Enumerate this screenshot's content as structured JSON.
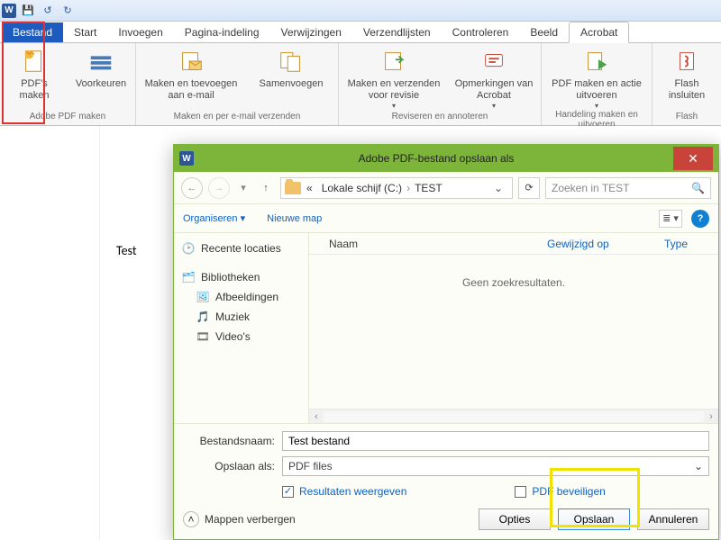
{
  "tabs": {
    "file": "Bestand",
    "home": "Start",
    "insert": "Invoegen",
    "layout": "Pagina-indeling",
    "refs": "Verwijzingen",
    "mail": "Verzendlijsten",
    "review": "Controleren",
    "view": "Beeld",
    "acrobat": "Acrobat"
  },
  "ribbon": {
    "g1": {
      "label": "Adobe PDF maken",
      "btn1": "PDF's maken",
      "btn2": "Voorkeuren"
    },
    "g2": {
      "label": "Maken en per e-mail verzenden",
      "btn1": "Maken en toevoegen aan e-mail",
      "btn2": "Samenvoegen"
    },
    "g3": {
      "label": "Reviseren en annoteren",
      "btn1": "Maken en verzenden voor revisie",
      "btn2": "Opmerkingen van Acrobat"
    },
    "g4": {
      "label": "Handeling maken en uitvoeren",
      "btn1": "PDF maken en actie uitvoeren"
    },
    "g5": {
      "label": "Flash",
      "btn1": "Flash insluiten"
    }
  },
  "doc": {
    "text": "Test "
  },
  "dialog": {
    "title": "Adobe PDF-bestand opslaan als",
    "breadcrumb": {
      "seg1": "Lokale schijf (C:)",
      "seg2": "TEST"
    },
    "search_placeholder": "Zoeken in TEST",
    "organize": "Organiseren",
    "newfolder": "Nieuwe map",
    "tree": {
      "recent": "Recente locaties",
      "libraries": "Bibliotheken",
      "pictures": "Afbeeldingen",
      "music": "Muziek",
      "videos": "Video's"
    },
    "columns": {
      "name": "Naam",
      "modified": "Gewijzigd op",
      "type": "Type"
    },
    "empty": "Geen zoekresultaten.",
    "filename_label": "Bestandsnaam:",
    "filename_value": "Test bestand",
    "saveas_label": "Opslaan als:",
    "saveas_value": "PDF files",
    "chk_results": "Resultaten weergeven",
    "chk_protect": "PDF beveiligen",
    "hide_folders": "Mappen verbergen",
    "btn_options": "Opties",
    "btn_save": "Opslaan",
    "btn_cancel": "Annuleren"
  }
}
